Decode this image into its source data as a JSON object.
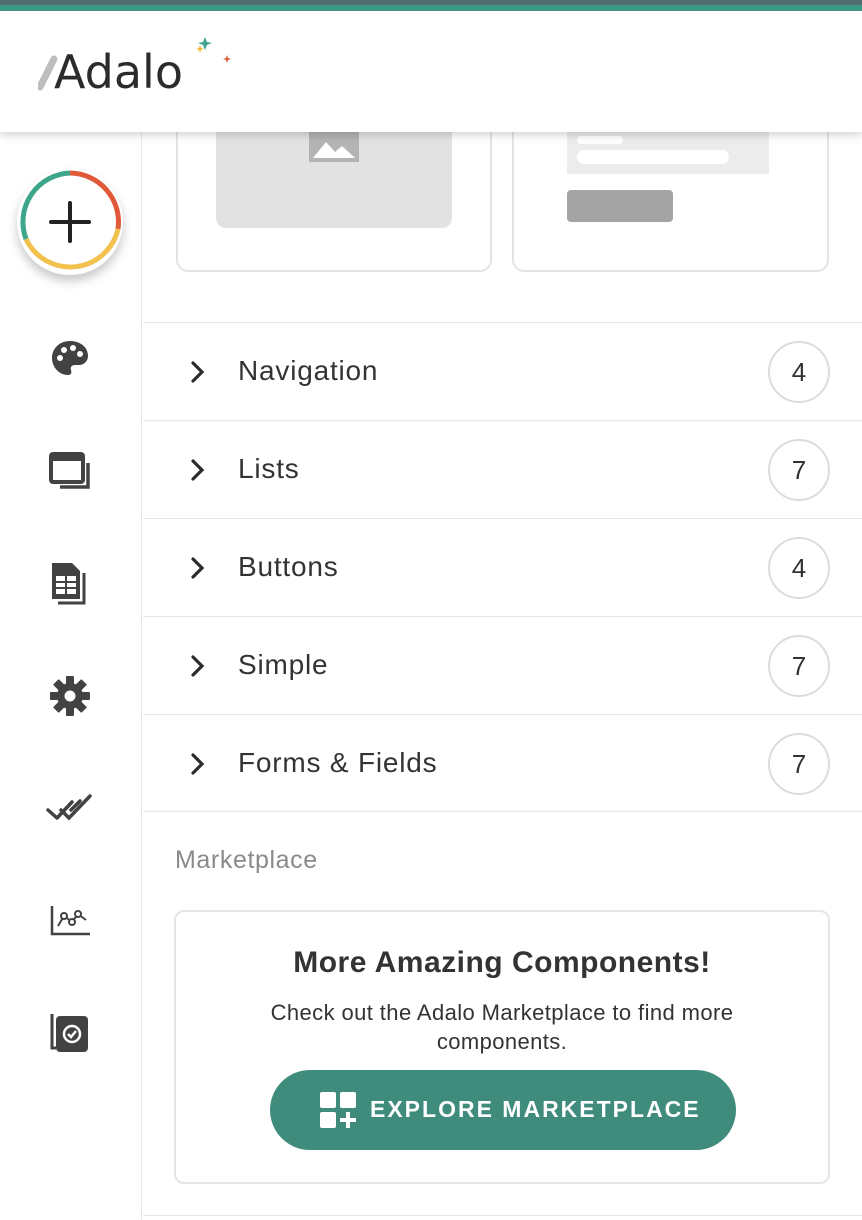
{
  "app": {
    "logo_text": "Adalo",
    "brand_color": "#3f8b7c",
    "stripe_colors": [
      "#4f6e6e",
      "#3f9a8a"
    ]
  },
  "sidebar": {
    "add_button": {
      "icon": "plus-icon",
      "ring_colors": [
        "#3da58a",
        "#e05a3a",
        "#f2c14e"
      ]
    },
    "items": [
      {
        "name": "branding",
        "icon": "palette-icon"
      },
      {
        "name": "screens",
        "icon": "screens-icon"
      },
      {
        "name": "database",
        "icon": "database-table-icon"
      },
      {
        "name": "settings",
        "icon": "gear-icon"
      },
      {
        "name": "publish",
        "icon": "double-check-icon"
      },
      {
        "name": "analytics",
        "icon": "analytics-chart-icon"
      },
      {
        "name": "components-library",
        "icon": "badge-check-icon"
      }
    ]
  },
  "component_categories": [
    {
      "label": "Navigation",
      "count": "4"
    },
    {
      "label": "Lists",
      "count": "7"
    },
    {
      "label": "Buttons",
      "count": "4"
    },
    {
      "label": "Simple",
      "count": "7"
    },
    {
      "label": "Forms & Fields",
      "count": "7"
    }
  ],
  "marketplace": {
    "section_title": "Marketplace",
    "heading": "More Amazing Components!",
    "description": "Check out the Adalo Marketplace to find more components.",
    "button_label": "EXPLORE MARKETPLACE",
    "button_icon": "add-grid-icon"
  }
}
